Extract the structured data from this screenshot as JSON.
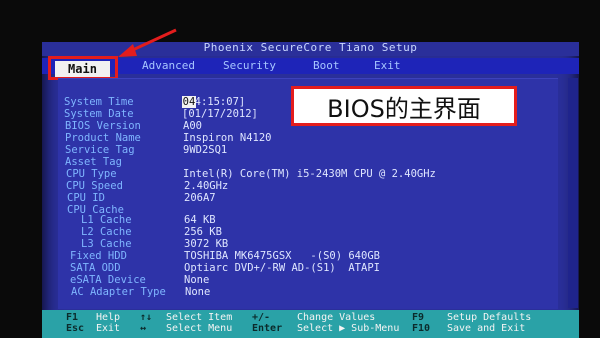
{
  "title": "Phoenix SecureCore Tiano Setup",
  "menu": {
    "items": [
      "Main",
      "Advanced",
      "Security",
      "Boot",
      "Exit"
    ],
    "selected": "Main"
  },
  "annotation": "BIOS的主界面",
  "system": [
    {
      "label": "System Time",
      "value": "[04:15:07]"
    },
    {
      "label": "System Date",
      "value": "[01/17/2012]"
    },
    {
      "label": "BIOS Version",
      "value": "A00"
    },
    {
      "label": "Product Name",
      "value": "Inspiron N4120"
    },
    {
      "label": "Service Tag",
      "value": "9WD2SQ1"
    },
    {
      "label": "Asset Tag",
      "value": ""
    },
    {
      "label": "CPU Type",
      "value": "Intel(R) Core(TM) i5-2430M CPU @ 2.40GHz"
    },
    {
      "label": "CPU Speed",
      "value": "2.40GHz"
    },
    {
      "label": "CPU ID",
      "value": "206A7"
    },
    {
      "label": "CPU Cache",
      "value": ""
    },
    {
      "label": "L1 Cache",
      "value": "64 KB"
    },
    {
      "label": "L2 Cache",
      "value": "256 KB"
    },
    {
      "label": "L3 Cache",
      "value": "3072 KB"
    },
    {
      "label": "Fixed HDD",
      "value": "TOSHIBA MK6475GSX   -(S0) 640GB"
    },
    {
      "label": "SATA ODD",
      "value": "Optiarc DVD+/-RW AD-(S1)  ATAPI"
    },
    {
      "label": "eSATA Device",
      "value": "None"
    },
    {
      "label": "AC Adapter Type",
      "value": "None"
    }
  ],
  "help": {
    "f1": "F1",
    "help": "Help",
    "arrows": "↑↓",
    "select_item": "Select Item",
    "plusminus": "+/-",
    "change_values": "Change Values",
    "f9": "F9",
    "setup_defaults": "Setup Defaults",
    "esc": "Esc",
    "exit": "Exit",
    "lr": "↔",
    "select_menu": "Select Menu",
    "enter": "Enter",
    "select_submenu": "Select ▶ Sub-Menu",
    "f10": "F10",
    "save_exit": "Save and Exit"
  },
  "colors": {
    "screen_blue": "#2a2f9a",
    "menu_blue": "#1e24b8",
    "help_cyan": "#2aa2a7",
    "annotation_red": "#e31d1d"
  }
}
